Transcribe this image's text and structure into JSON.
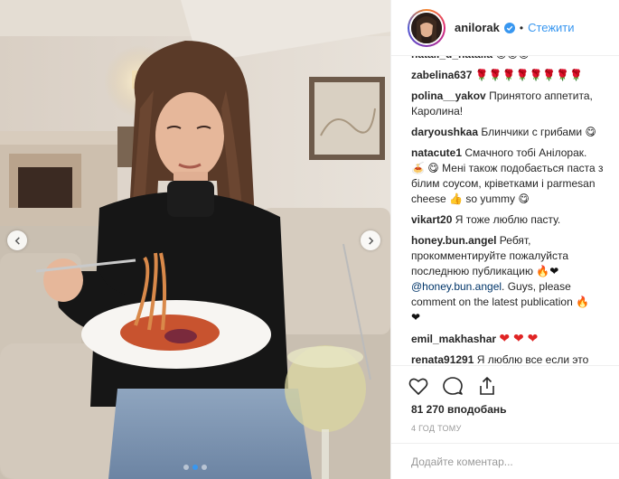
{
  "header": {
    "username": "anilorak",
    "separator": "•",
    "follow_label": "Стежити"
  },
  "photo": {
    "slide_count": 3,
    "active_slide": 2
  },
  "comments": [
    {
      "user": "natali_d_natalia",
      "text": "",
      "emojis": [
        "grin",
        "grin",
        "grin"
      ],
      "cut": true
    },
    {
      "user": "zabelina637",
      "text": "",
      "emojis": [
        "rose",
        "rose",
        "rose",
        "rose",
        "rose",
        "rose",
        "rose",
        "rose"
      ]
    },
    {
      "user": "polina__yakov",
      "text": "Принятого аппетита, Каролина!"
    },
    {
      "user": "daryoushkaa",
      "text": "Блинчики с грибами",
      "emojis": [
        "grin"
      ]
    },
    {
      "user": "natacute1",
      "text": "Смачного тобі Анілорак.",
      "line2_pre_emojis": [
        "drool",
        "drool"
      ],
      "text2": "Мені також подобається паста з білим соусом, кріветками і parmesan cheese",
      "emojis_mid": [
        "thumb"
      ],
      "text3": "so yummy",
      "emojis_end": [
        "yum"
      ]
    },
    {
      "user": "vikart20",
      "text": "Я тоже люблю пасту."
    },
    {
      "user": "honey.bun.angel",
      "text": "Ребят, прокомментируйте пожалуйста последнюю публикацию",
      "emojis_mid": [
        "fire",
        "black_heart"
      ],
      "mention": "@honey.bun.angel",
      "text2": ". Guys, please comment on the latest publication",
      "emojis_end": [
        "fire",
        "black_heart"
      ]
    },
    {
      "user": "emil_makhashar",
      "text": "",
      "hearts": 3
    },
    {
      "user": "renata91291",
      "text": "Я люблю все если это очень вкусно. Мамины блюда"
    }
  ],
  "likes": {
    "count": "81 270",
    "label": "вподобань"
  },
  "time": "4 ГОД ТОМУ",
  "add_comment": {
    "placeholder": "Додайте коментар..."
  },
  "colors": {
    "accent": "#3897f0",
    "border": "#efefef",
    "muted": "#999999",
    "heart": "#e02424"
  }
}
